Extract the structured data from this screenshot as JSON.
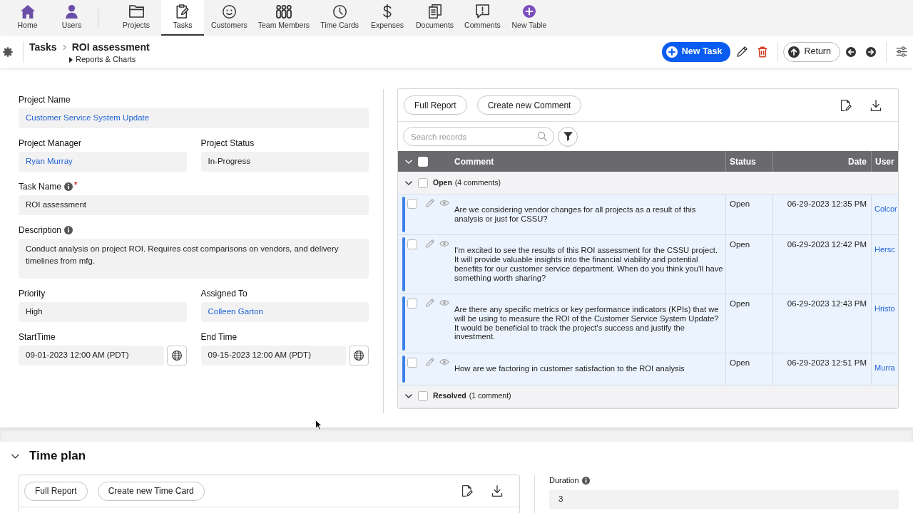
{
  "nav": {
    "apps": [
      {
        "label": "Home",
        "selected": false
      },
      {
        "label": "Users",
        "selected": false
      }
    ],
    "tables": [
      {
        "label": "Projects",
        "selected": false
      },
      {
        "label": "Tasks",
        "selected": true
      },
      {
        "label": "Customers",
        "selected": false
      },
      {
        "label": "Team Members",
        "selected": false
      },
      {
        "label": "Time Cards",
        "selected": false
      },
      {
        "label": "Expenses",
        "selected": false
      },
      {
        "label": "Documents",
        "selected": false
      },
      {
        "label": "Comments",
        "selected": false
      },
      {
        "label": "New Table",
        "selected": false
      }
    ]
  },
  "header": {
    "breadcrumb": {
      "parent": "Tasks",
      "current": "ROI assessment"
    },
    "reports_link": {
      "label": "Reports & Charts",
      "expanded": false
    },
    "new_button": "New Task",
    "return_button": "Return"
  },
  "form": {
    "rows": [
      [
        {
          "label": "Project Name",
          "value": "Customer Service System Update",
          "kind": "link"
        }
      ],
      [
        {
          "label": "Project Manager",
          "value": "Ryan Murray",
          "kind": "link"
        },
        {
          "label": "Project Status",
          "value": "In-Progress",
          "kind": "text"
        }
      ],
      [
        {
          "label": "Task Name",
          "info": true,
          "required_mark": "*",
          "value": "ROI assessment",
          "kind": "text"
        }
      ],
      [
        {
          "label": "Description",
          "info": true,
          "value": "Conduct analysis on project ROI. Requires cost comparisons on vendors, and delivery timelines from mfg.",
          "kind": "textarea"
        }
      ],
      [
        {
          "label": "Priority",
          "value": "High",
          "kind": "text"
        },
        {
          "label": "Assigned To",
          "value": "Colleen Garton",
          "kind": "link"
        }
      ],
      [
        {
          "label": "StartTime",
          "value": "09-01-2023 12:00 AM (PDT)",
          "kind": "datetime"
        },
        {
          "label": "End Time",
          "value": "09-15-2023 12:00 AM (PDT)",
          "kind": "datetime"
        }
      ]
    ]
  },
  "comments": {
    "buttons": [
      "Full Report",
      "Create new Comment"
    ],
    "search": {
      "placeholder": "Search records"
    },
    "columns": [
      "Comment",
      "Status",
      "Date",
      "User"
    ],
    "select_all": {
      "checked": false
    },
    "groups": [
      {
        "label": "Open",
        "count": "(4 comments)",
        "expanded": true,
        "checked": false,
        "rows": [
          {
            "comment": "Are we considering vendor changes for all projects as a result of this analysis or just for CSSU?",
            "status": "Open",
            "date": "06-29-2023 12:35 PM",
            "user": "Colcor",
            "checked": false
          },
          {
            "comment": "I'm excited to see the results of this ROI assessment for the CSSU project. It will provide valuable insights into the financial viability and potential benefits for our customer service department. When do you think you'll have something worth sharing?",
            "status": "Open",
            "date": "06-29-2023 12:42 PM",
            "user": "Hersc",
            "checked": false
          },
          {
            "comment": "Are there any specific metrics or key performance indicators (KPIs) that we will be using to measure the ROI of the Customer Service System Update? It would be beneficial to track the project's success and justify the investment.",
            "status": "Open",
            "date": "06-29-2023 12:43 PM",
            "user": "Hristo",
            "checked": false
          },
          {
            "comment": "How are we factoring in customer satisfaction to the ROI analysis",
            "status": "Open",
            "date": "06-29-2023 12:51 PM",
            "user": "Murra",
            "checked": false
          }
        ]
      },
      {
        "label": "Resolved",
        "count": "(1 comment)",
        "expanded": true,
        "checked": false
      }
    ]
  },
  "time_plan": {
    "title": "Time plan",
    "expanded": true,
    "buttons": [
      "Full Report",
      "Create new Time Card"
    ],
    "duration": {
      "label": "Duration",
      "info": true,
      "value": "3"
    }
  }
}
